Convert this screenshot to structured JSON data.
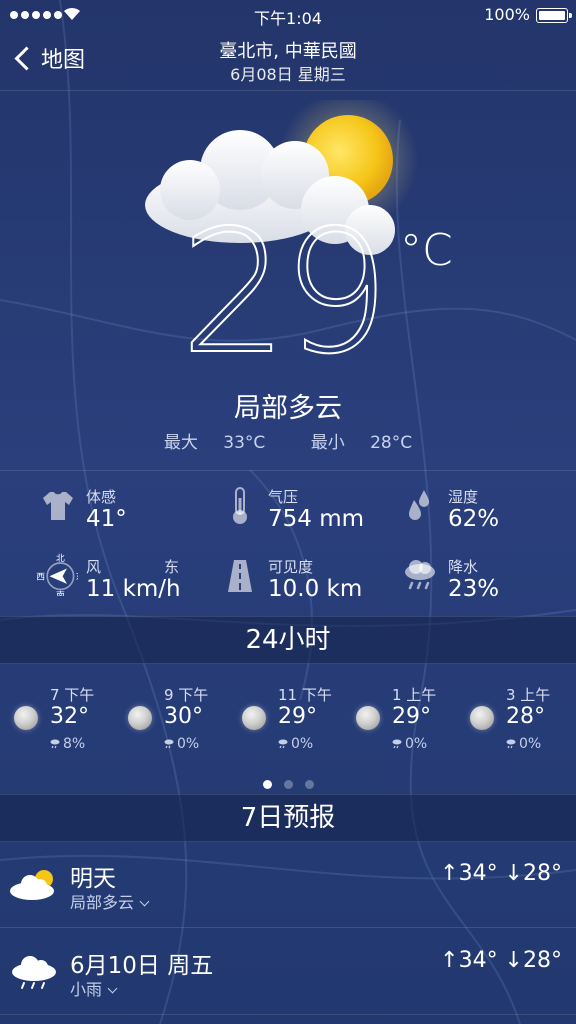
{
  "status_bar": {
    "time": "下午1:04",
    "battery": "100%"
  },
  "header": {
    "back_label": "地图",
    "location": "臺北市, 中華民國",
    "date": "6月08日 星期三"
  },
  "current": {
    "temperature": "29",
    "unit": "°C",
    "condition": "局部多云",
    "max_label": "最大",
    "max_value": "33°C",
    "min_label": "最小",
    "min_value": "28°C"
  },
  "details": {
    "feels_like": {
      "label": "体感",
      "value": "41°",
      "icon": "tshirt-icon"
    },
    "pressure": {
      "label": "气压",
      "value": "754 mm",
      "icon": "thermometer-icon"
    },
    "humidity": {
      "label": "湿度",
      "value": "62%",
      "icon": "droplets-icon"
    },
    "wind": {
      "label": "风",
      "direction": "东",
      "value": "11 km/h",
      "icon": "compass-icon",
      "compass": {
        "n": "北",
        "s": "南",
        "w": "西",
        "e": "东"
      }
    },
    "visibility": {
      "label": "可见度",
      "value": "10.0 km",
      "icon": "road-icon"
    },
    "precipitation": {
      "label": "降水",
      "value": "23%",
      "icon": "rain-cloud-icon"
    }
  },
  "hourly": {
    "title": "24小时",
    "items": [
      {
        "time": "7 下午",
        "temp": "32°",
        "precip": "8%",
        "icon": "moon-icon"
      },
      {
        "time": "9 下午",
        "temp": "30°",
        "precip": "0%",
        "icon": "moon-icon"
      },
      {
        "time": "11 下午",
        "temp": "29°",
        "precip": "0%",
        "icon": "moon-icon"
      },
      {
        "time": "1 上午",
        "temp": "29°",
        "precip": "0%",
        "icon": "moon-icon"
      },
      {
        "time": "3 上午",
        "temp": "28°",
        "precip": "0%",
        "icon": "moon-icon"
      }
    ],
    "pages": 3,
    "active_page": 1
  },
  "forecast": {
    "title": "7日预报",
    "days": [
      {
        "name": "明天",
        "condition": "局部多云",
        "range": "↑34° ↓28°",
        "icon": "partly-cloudy-icon"
      },
      {
        "name": "6月10日 周五",
        "condition": "小雨",
        "range": "↑34° ↓28°",
        "icon": "rain-icon"
      }
    ]
  },
  "colors": {
    "background": "#23356a",
    "text": "#ffffff",
    "secondary_text": "#c5cfea",
    "sun": "#f5c518"
  }
}
